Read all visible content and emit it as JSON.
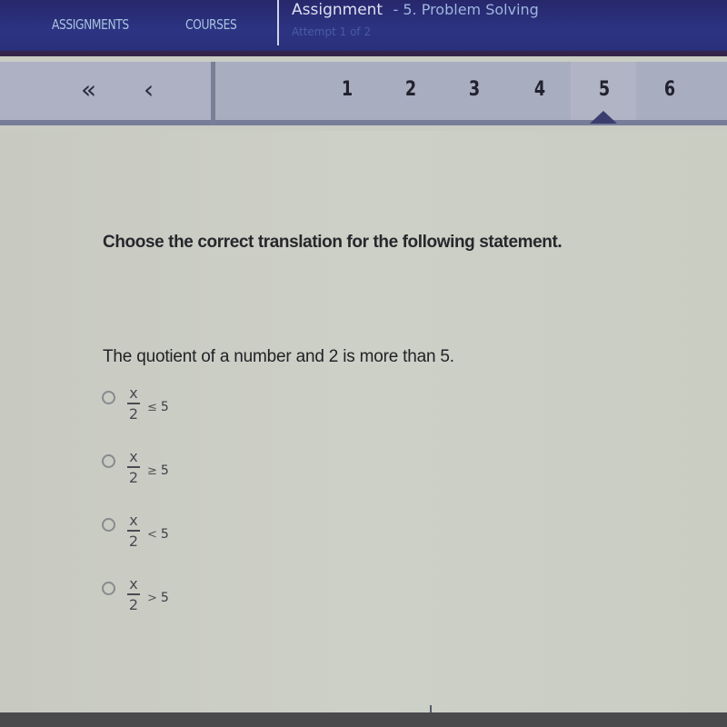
{
  "topbar": {
    "nav_assignments": "ASSIGNMENTS",
    "nav_courses": "COURSES",
    "assignment_label": "Assignment",
    "assignment_name": "- 5. Problem Solving",
    "attempt": "Attempt 1 of 2"
  },
  "question_nav": {
    "first_icon": "double-chevron-left-icon",
    "first_glyph": "«",
    "prev_icon": "chevron-left-icon",
    "prev_glyph": "‹",
    "numbers": [
      "1",
      "2",
      "3",
      "4",
      "5",
      "6"
    ],
    "active": "5"
  },
  "question": {
    "instruction": "Choose the correct translation for the following statement.",
    "statement": "The quotient of a number and 2 is more than 5.",
    "options": [
      {
        "numerator": "x",
        "denominator": "2",
        "operator": "≤",
        "value": "5",
        "selected": false
      },
      {
        "numerator": "x",
        "denominator": "2",
        "operator": "≥",
        "value": "5",
        "selected": false
      },
      {
        "numerator": "x",
        "denominator": "2",
        "operator": "<",
        "value": "5",
        "selected": false
      },
      {
        "numerator": "x",
        "denominator": "2",
        "operator": ">",
        "value": "5",
        "selected": false
      }
    ]
  },
  "colors": {
    "topbar": "#2c3483",
    "accent_caret": "#3a3d6e",
    "nav_link": "#a9c3de"
  }
}
